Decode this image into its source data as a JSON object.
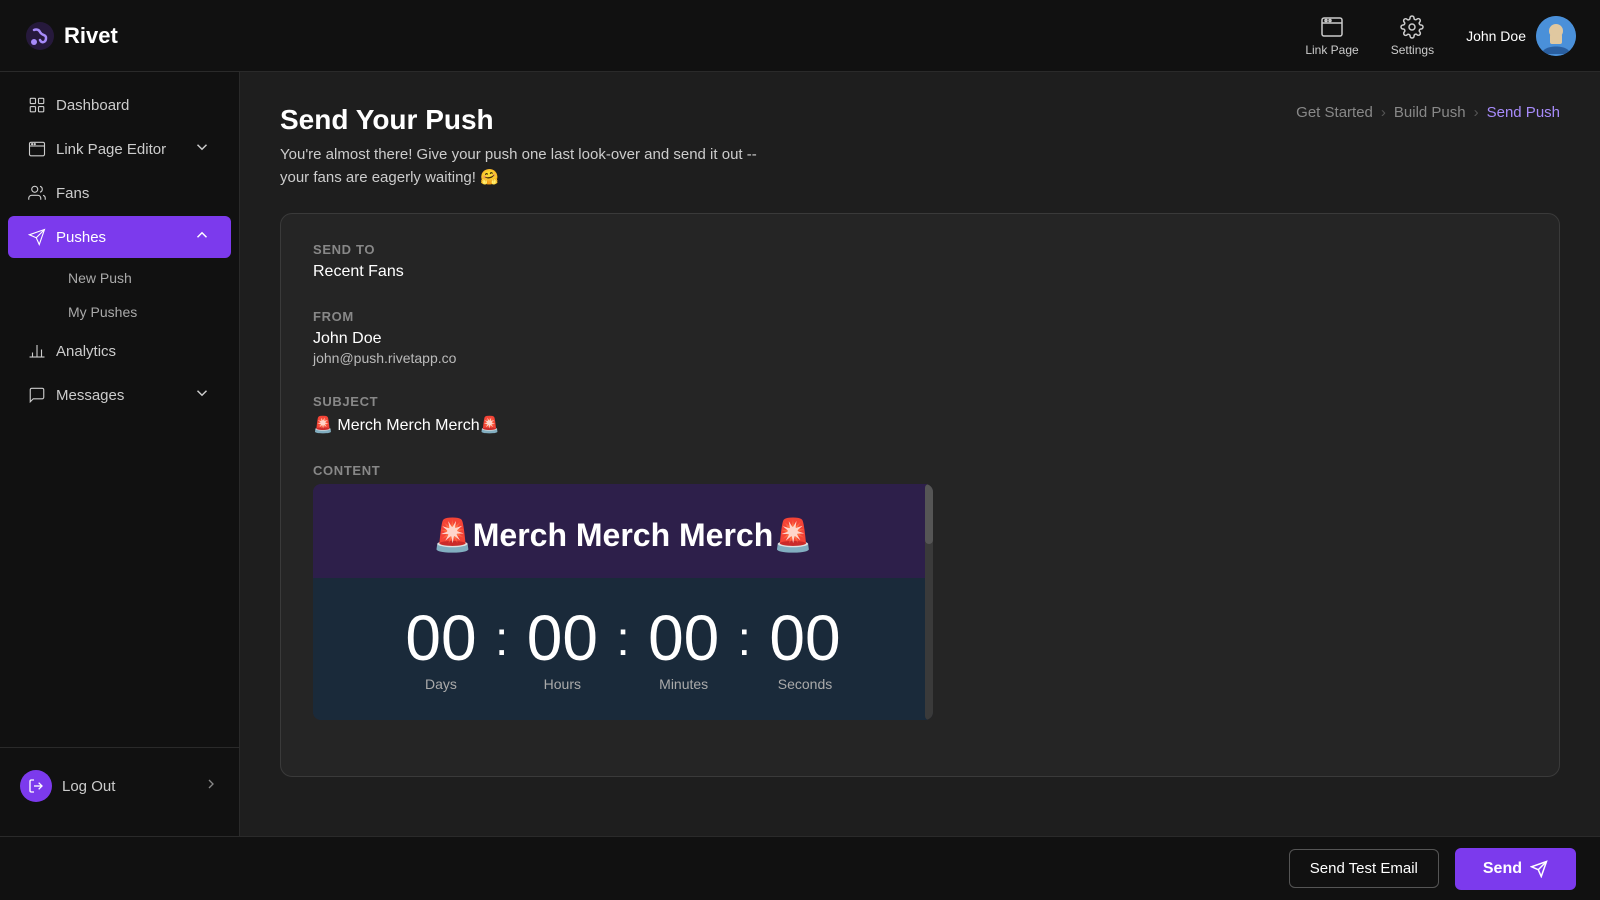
{
  "app": {
    "name": "Rivet"
  },
  "topnav": {
    "link_page_label": "Link Page",
    "settings_label": "Settings",
    "user_name": "John Doe"
  },
  "sidebar": {
    "items": [
      {
        "id": "dashboard",
        "label": "Dashboard",
        "icon": "grid-icon",
        "active": false
      },
      {
        "id": "link-page-editor",
        "label": "Link Page Editor",
        "icon": "browser-icon",
        "active": false,
        "expandable": true
      },
      {
        "id": "fans",
        "label": "Fans",
        "icon": "users-icon",
        "active": false
      },
      {
        "id": "pushes",
        "label": "Pushes",
        "icon": "push-icon",
        "active": true,
        "expandable": true
      }
    ],
    "sub_items": [
      {
        "id": "new-push",
        "label": "New Push"
      },
      {
        "id": "my-pushes",
        "label": "My Pushes"
      }
    ],
    "bottom_items": [
      {
        "id": "analytics",
        "label": "Analytics",
        "icon": "chart-icon"
      },
      {
        "id": "messages",
        "label": "Messages",
        "icon": "message-icon",
        "expandable": true
      }
    ],
    "logout_label": "Log Out"
  },
  "page": {
    "title": "Send Your Push",
    "subtitle": "You're almost there! Give your push one last look-over and send it out --\nyour fans are eagerly waiting! 🤗",
    "breadcrumb": {
      "steps": [
        {
          "label": "Get Started",
          "active": false
        },
        {
          "label": "Build Push",
          "active": false
        },
        {
          "label": "Send Push",
          "active": true
        }
      ]
    }
  },
  "push_details": {
    "send_to_label": "Send To",
    "send_to_value": "Recent Fans",
    "from_label": "From",
    "from_name": "John Doe",
    "from_email": "john@push.rivetapp.co",
    "subject_label": "Subject",
    "subject_value": "🚨 Merch Merch Merch🚨",
    "content_label": "Content",
    "preview_title": "🚨Merch Merch Merch🚨",
    "countdown": {
      "days": "00",
      "hours": "00",
      "minutes": "00",
      "seconds": "00",
      "labels": [
        "Days",
        "Hours",
        "Minutes",
        "Seconds"
      ]
    }
  },
  "bottom_bar": {
    "send_test_label": "Send Test Email",
    "send_label": "Send"
  }
}
